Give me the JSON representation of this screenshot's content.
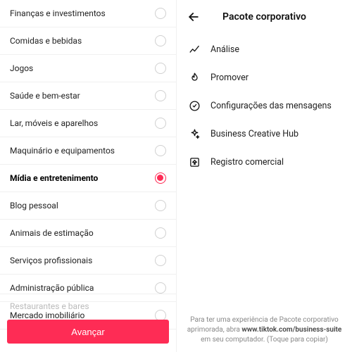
{
  "left": {
    "categories": [
      {
        "label": "Finanças e investimentos",
        "selected": false
      },
      {
        "label": "Comidas e bebidas",
        "selected": false
      },
      {
        "label": "Jogos",
        "selected": false
      },
      {
        "label": "Saúde e bem-estar",
        "selected": false
      },
      {
        "label": "Lar, móveis e aparelhos",
        "selected": false
      },
      {
        "label": "Maquinário e equipamentos",
        "selected": false
      },
      {
        "label": "Mídia e entretenimento",
        "selected": true
      },
      {
        "label": "Blog pessoal",
        "selected": false
      },
      {
        "label": "Animais de estimação",
        "selected": false
      },
      {
        "label": "Serviços profissionais",
        "selected": false
      },
      {
        "label": "Administração pública",
        "selected": false
      },
      {
        "label": "Mercado imobiliário",
        "selected": false
      }
    ],
    "truncated_row": "Restaurantes e bares",
    "next_button": "Avançar"
  },
  "right": {
    "title": "Pacote corporativo",
    "items": [
      {
        "icon": "analytics",
        "label": "Análise"
      },
      {
        "icon": "flame",
        "label": "Promover"
      },
      {
        "icon": "clock-check",
        "label": "Configurações das mensagens"
      },
      {
        "icon": "sparkle",
        "label": "Business Creative Hub"
      },
      {
        "icon": "register",
        "label": "Registro comercial"
      }
    ],
    "footer_pre": "Para ter uma experiência de Pacote corporativo aprimorada, abra ",
    "footer_link": "www.tiktok.com/business-suite",
    "footer_post": " em seu computador. (Toque para copiar)"
  }
}
